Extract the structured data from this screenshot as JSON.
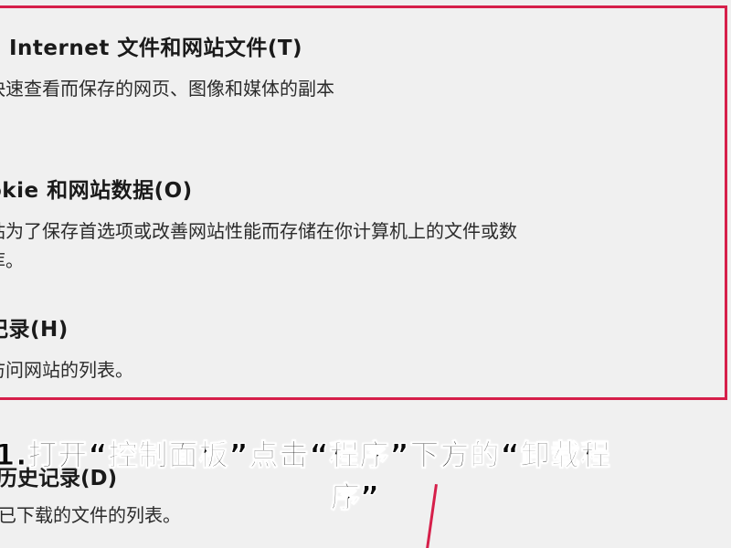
{
  "options": [
    {
      "title": "Internet 文件和网站文件(T)",
      "desc": "快速查看而保存的网页、图像和媒体的副本",
      "desc2": ""
    },
    {
      "title": "okie 和网站数据(O)",
      "desc": "站为了保存首选项或改善网站性能而存储在你计算机上的文件或数",
      "desc2": "库。"
    },
    {
      "title": "记录(H)",
      "desc": "访问网站的列表。",
      "desc2": ""
    }
  ],
  "downloads": {
    "title": "历史记录(D)",
    "desc": "已下载的文件的列表。"
  },
  "caption": {
    "line1": "1.打开“控制面板”点击“程序”下方的“卸载程",
    "line2": "序”"
  },
  "colors": {
    "highlight": "#d61f4a",
    "background": "#f0f0f0"
  }
}
